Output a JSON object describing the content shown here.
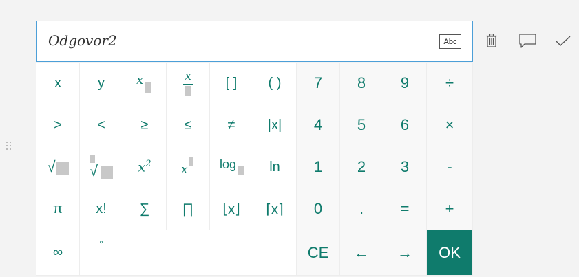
{
  "input": {
    "value": "Odgovor2",
    "format_button_label": "Abc"
  },
  "icons": {
    "delete": "trash-icon",
    "comment": "comment-icon",
    "confirm": "check-icon",
    "drag": "drag-handle-icon"
  },
  "keys": {
    "x": "x",
    "y": "y",
    "brackets": "[ ]",
    "parens": "( )",
    "abs_paren": "|x|",
    "gt": ">",
    "lt": "<",
    "ge": "≥",
    "le": "≤",
    "ne": "≠",
    "sqrt": "√",
    "x_squared_base": "x",
    "x_squared_exp": "2",
    "x_power_base": "x",
    "log": "log",
    "ln": "ln",
    "pi": "π",
    "factorial": "x!",
    "sum": "∑",
    "product": "∏",
    "floor": "⌊x⌋",
    "ceil": "⌈x⌉",
    "infinity": "∞",
    "degree": "°",
    "sub_x": "x",
    "frac_x": "x",
    "n7": "7",
    "n8": "8",
    "n9": "9",
    "divide": "÷",
    "n4": "4",
    "n5": "5",
    "n6": "6",
    "multiply": "×",
    "n1": "1",
    "n2": "2",
    "n3": "3",
    "minus": "-",
    "n0": "0",
    "dot": ".",
    "equals": "=",
    "plus": "+",
    "ce": "CE",
    "left": "←",
    "right": "→",
    "ok": "OK"
  },
  "colors": {
    "accent": "#0f7b6c",
    "focus_border": "#4c9fd8"
  }
}
